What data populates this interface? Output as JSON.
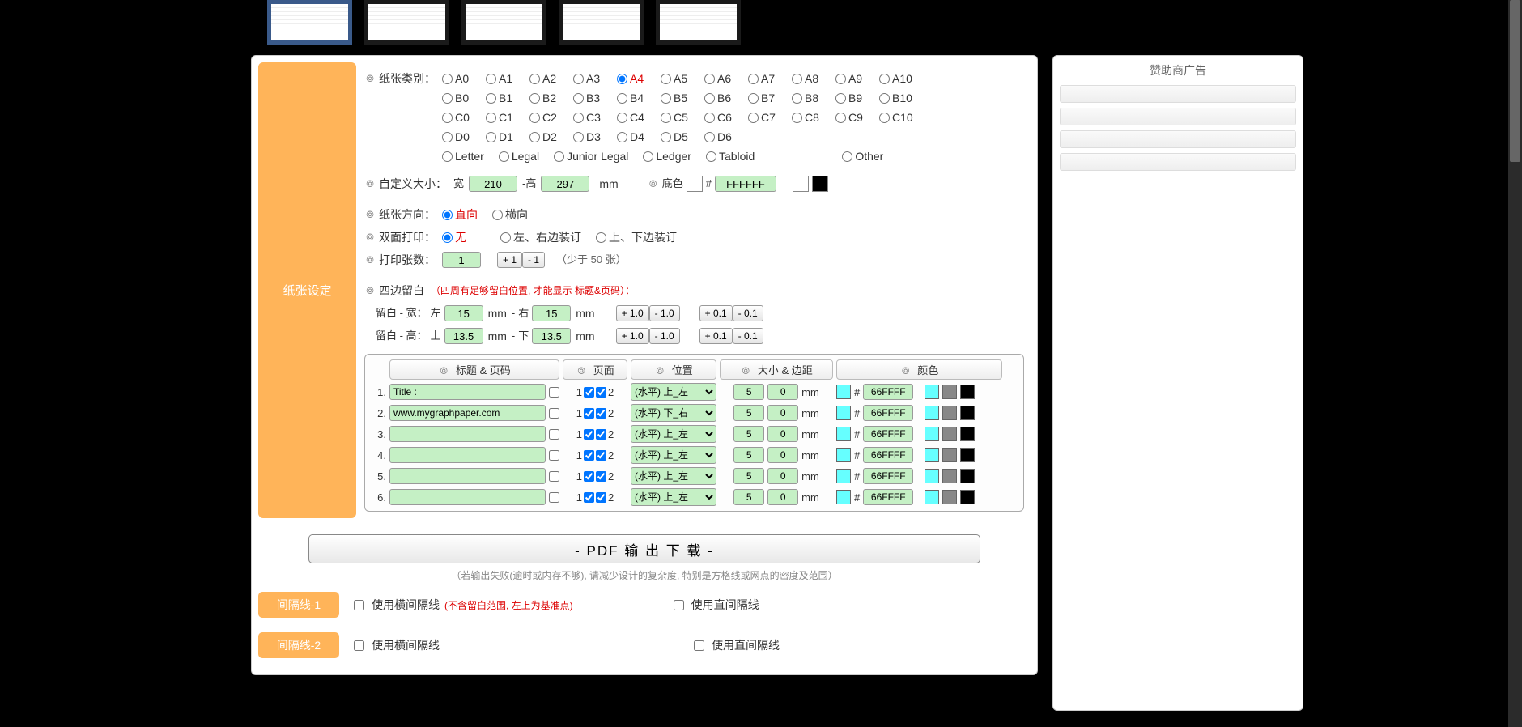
{
  "paper": {
    "label_type": "纸张类别：",
    "series_a": [
      "A0",
      "A1",
      "A2",
      "A3",
      "A4",
      "A5",
      "A6",
      "A7",
      "A8",
      "A9",
      "A10"
    ],
    "series_b": [
      "B0",
      "B1",
      "B2",
      "B3",
      "B4",
      "B5",
      "B6",
      "B7",
      "B8",
      "B9",
      "B10"
    ],
    "series_c": [
      "C0",
      "C1",
      "C2",
      "C3",
      "C4",
      "C5",
      "C6",
      "C7",
      "C8",
      "C9",
      "C10"
    ],
    "series_d": [
      "D0",
      "D1",
      "D2",
      "D3",
      "D4",
      "D5",
      "D6"
    ],
    "series_other": [
      "Letter",
      "Legal",
      "Junior Legal",
      "Ledger",
      "Tabloid"
    ],
    "other_label": "Other",
    "selected": "A4",
    "label_custom": "自定义大小：",
    "label_w": "宽",
    "label_h": "高",
    "width": "210",
    "height": "297",
    "unit_mm": "mm",
    "label_bg": "底色",
    "hash": "#",
    "bg_hex": "FFFFFF",
    "swatch_white": "#ffffff",
    "swatch_black": "#000000",
    "label_orient": "纸张方向：",
    "orient_portrait": "直向",
    "orient_landscape": "横向",
    "label_duplex": "双面打印：",
    "duplex_none": "无",
    "duplex_lr": "左、右边装订",
    "duplex_tb": "上、下边装订",
    "label_copies": "打印张数：",
    "copies": "1",
    "btn_plus1": "+ 1",
    "btn_minus1": "- 1",
    "copies_note": "（少于 50 张）",
    "margin_title": "四边留白",
    "margin_note": "（四周有足够留白位置, 才能显示 标题&页码）：",
    "margin_w_lbl": "留白 - 宽：",
    "margin_h_lbl": "留白 - 高：",
    "lbl_left": "左",
    "lbl_right": "右",
    "lbl_top": "上",
    "lbl_bottom": "下",
    "margin_left": "15",
    "margin_right": "15",
    "margin_top": "13.5",
    "margin_bottom": "13.5",
    "btn_p10": "+ 1.0",
    "btn_m10": "- 1.0",
    "btn_p01": "+ 0.1",
    "btn_m01": "- 0.1",
    "dash": " - "
  },
  "panel_tab": "纸张设定",
  "table": {
    "hdr_title": "标题 & 页码",
    "hdr_page": "页面",
    "hdr_pos": "位置",
    "hdr_size": "大小 & 边距",
    "hdr_color": "颜色",
    "page_lbl_1": "1",
    "page_lbl_2": "2",
    "size_unit": "mm",
    "rows": [
      {
        "n": "1.",
        "text": "Title :",
        "pos": "(水平) 上_左",
        "s1": "5",
        "s2": "0",
        "hex": "66FFFF"
      },
      {
        "n": "2.",
        "text": "www.mygraphpaper.com",
        "pos": "(水平) 下_右",
        "s1": "5",
        "s2": "0",
        "hex": "66FFFF"
      },
      {
        "n": "3.",
        "text": "",
        "pos": "(水平) 上_左",
        "s1": "5",
        "s2": "0",
        "hex": "66FFFF"
      },
      {
        "n": "4.",
        "text": "",
        "pos": "(水平) 上_左",
        "s1": "5",
        "s2": "0",
        "hex": "66FFFF"
      },
      {
        "n": "5.",
        "text": "",
        "pos": "(水平) 上_左",
        "s1": "5",
        "s2": "0",
        "hex": "66FFFF"
      },
      {
        "n": "6.",
        "text": "",
        "pos": "(水平) 上_左",
        "s1": "5",
        "s2": "0",
        "hex": "66FFFF"
      }
    ],
    "color_swatches": [
      "#66FFFF",
      "#888888",
      "#000000"
    ]
  },
  "download": {
    "btn": "- PDF 输 出 下 载 -",
    "note": "（若输出失败(逾时或内存不够), 请减少设计的复杂度, 特别是方格线或网点的密度及范围）"
  },
  "sep1": {
    "tab": "间隔线-1",
    "h_label": "使用横间隔线",
    "h_note": "(不含留白范围, 左上为基准点)",
    "v_label": "使用直间隔线"
  },
  "sep2": {
    "tab": "间隔线-2",
    "h_label": "使用横间隔线",
    "v_label": "使用直间隔线"
  },
  "sidebar": {
    "title": "赞助商广告"
  },
  "help_glyph": "⦾"
}
